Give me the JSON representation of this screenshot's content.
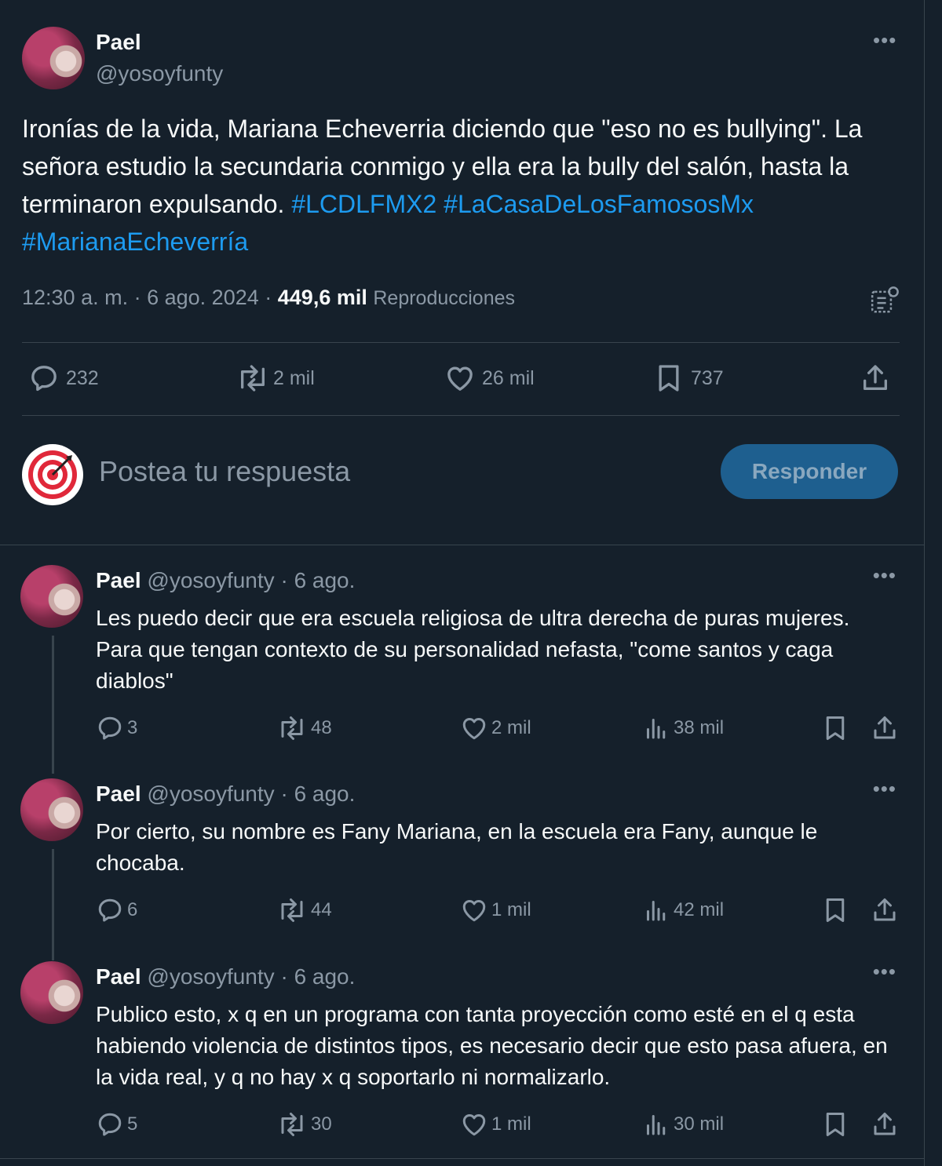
{
  "main": {
    "name": "Pael",
    "handle": "@yosoyfunty",
    "text_plain": "Ironías de la vida, Mariana Echeverria diciendo que \"eso no es bullying\". La señora estudio la secundaria conmigo y ella era la bully del salón, hasta la terminaron expulsando.",
    "hashtags": [
      "#LCDLFMX2",
      "#LaCasaDeLosFamososMx",
      "#MarianaEcheverría"
    ],
    "time": "12:30 a. m.",
    "date": "6 ago. 2024",
    "views_count": "449,6 mil",
    "views_label": "Reproducciones",
    "stats": {
      "replies": "232",
      "reposts": "2 mil",
      "likes": "26 mil",
      "bookmarks": "737"
    }
  },
  "compose": {
    "placeholder": "Postea tu respuesta",
    "button_label": "Responder"
  },
  "replies": [
    {
      "name": "Pael",
      "handle": "@yosoyfunty",
      "date": "6 ago.",
      "text": "Les puedo decir que era escuela religiosa de ultra derecha de puras mujeres. Para que tengan contexto de su personalidad nefasta, \"come santos y caga diablos\"",
      "replies": "3",
      "reposts": "48",
      "likes": "2 mil",
      "views": "38 mil"
    },
    {
      "name": "Pael",
      "handle": "@yosoyfunty",
      "date": "6 ago.",
      "text": "Por cierto, su nombre es Fany Mariana, en la escuela era Fany, aunque le chocaba.",
      "replies": "6",
      "reposts": "44",
      "likes": "1 mil",
      "views": "42 mil"
    },
    {
      "name": "Pael",
      "handle": "@yosoyfunty",
      "date": "6 ago.",
      "text": "Publico esto, x q en un programa con tanta proyección como esté en el q esta habiendo violencia de distintos tipos, es necesario decir que esto pasa afuera, en la vida real, y q no hay x q soportarlo ni normalizarlo.",
      "replies": "5",
      "reposts": "30",
      "likes": "1 mil",
      "views": "30 mil"
    }
  ],
  "icons": {
    "more": "more-dots-icon",
    "reply": "reply-bubble-icon",
    "repost": "repost-arrows-icon",
    "like": "heart-icon",
    "bookmark": "bookmark-icon",
    "share": "share-upload-icon",
    "views": "views-bars-icon",
    "analytics": "post-analytics-icon"
  },
  "colors": {
    "background": "#15202b",
    "text": "#f7f9f9",
    "muted": "#8b98a5",
    "link": "#1d9bf0",
    "button": "#1e5f8f",
    "border": "#38444d"
  }
}
